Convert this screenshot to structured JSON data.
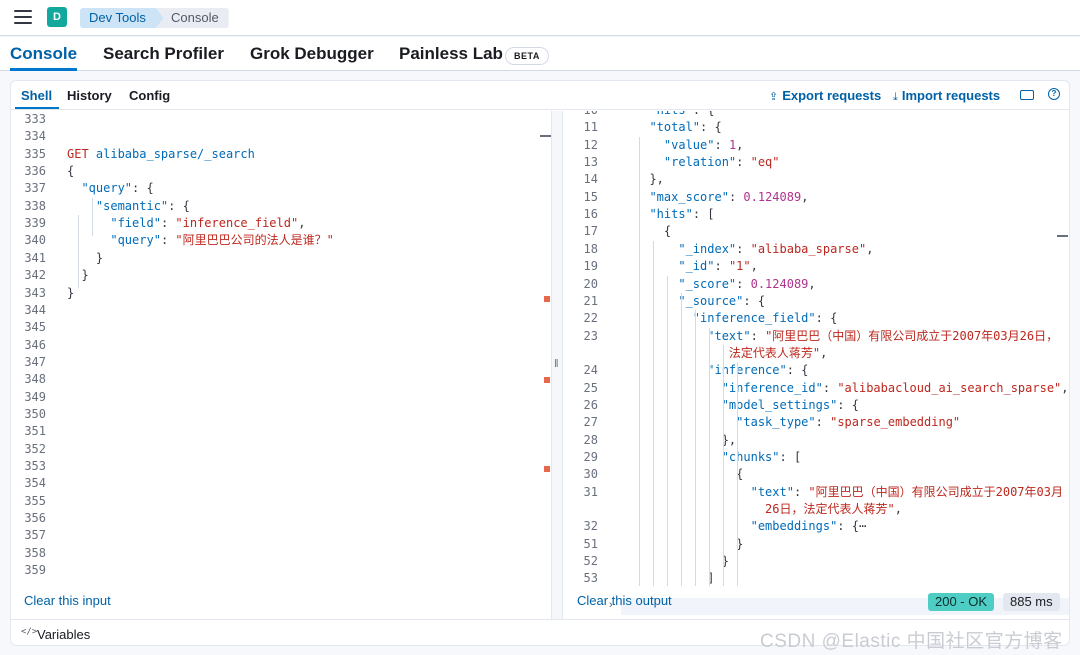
{
  "breadcrumbs": {
    "avatar_letter": "D",
    "root": "Dev Tools",
    "current": "Console"
  },
  "app_tabs": [
    "Console",
    "Search Profiler",
    "Grok Debugger",
    "Painless Lab"
  ],
  "beta_badge": "BETA",
  "sub_tabs": [
    "Shell",
    "History",
    "Config"
  ],
  "actions": {
    "export": "Export requests",
    "import": "Import requests"
  },
  "help_glyph": "?",
  "input_gutter": [
    "333",
    "334",
    "335",
    "336",
    "337",
    "338",
    "339",
    "340",
    "341",
    "342",
    "343",
    "344",
    "345",
    "346",
    "347",
    "348",
    "349",
    "350",
    "351",
    "352",
    "353",
    "354",
    "355",
    "356",
    "357",
    "358",
    "359"
  ],
  "input_code": [
    {
      "n": 2,
      "parts": [
        [
          "kw",
          "GET "
        ],
        [
          "path",
          "alibaba_sparse/_search"
        ]
      ]
    },
    {
      "n": 3,
      "parts": [
        [
          "pun",
          "{"
        ]
      ]
    },
    {
      "n": 4,
      "parts": [
        [
          "pun",
          "  "
        ],
        [
          "key",
          "\"query\""
        ],
        [
          "pun",
          ": {"
        ]
      ]
    },
    {
      "n": 5,
      "parts": [
        [
          "pun",
          "    "
        ],
        [
          "key",
          "\"semantic\""
        ],
        [
          "pun",
          ": {"
        ]
      ]
    },
    {
      "n": 6,
      "parts": [
        [
          "pun",
          "      "
        ],
        [
          "key",
          "\"field\""
        ],
        [
          "pun",
          ": "
        ],
        [
          "str",
          "\"inference_field\""
        ],
        [
          "pun",
          ","
        ]
      ]
    },
    {
      "n": 7,
      "parts": [
        [
          "pun",
          "      "
        ],
        [
          "key",
          "\"query\""
        ],
        [
          "pun",
          ": "
        ],
        [
          "str",
          "\"阿里巴巴公司的法人是谁？\""
        ]
      ]
    },
    {
      "n": 8,
      "parts": [
        [
          "pun",
          "    }"
        ]
      ]
    },
    {
      "n": 9,
      "parts": [
        [
          "pun",
          "  }"
        ]
      ]
    },
    {
      "n": 10,
      "parts": [
        [
          "pun",
          "}"
        ]
      ]
    }
  ],
  "output_lines": [
    {
      "ln": "10",
      "parts": [
        [
          "pun",
          "  "
        ],
        [
          "key",
          "\"hits\""
        ],
        [
          "pun",
          ": {"
        ]
      ]
    },
    {
      "ln": "11",
      "parts": [
        [
          "pun",
          "  "
        ],
        [
          "key",
          "\"total\""
        ],
        [
          "pun",
          ": {"
        ]
      ]
    },
    {
      "ln": "12",
      "parts": [
        [
          "pun",
          "    "
        ],
        [
          "key",
          "\"value\""
        ],
        [
          "pun",
          ": "
        ],
        [
          "num",
          "1"
        ],
        [
          "pun",
          ","
        ]
      ]
    },
    {
      "ln": "13",
      "parts": [
        [
          "pun",
          "    "
        ],
        [
          "key",
          "\"relation\""
        ],
        [
          "pun",
          ": "
        ],
        [
          "str",
          "\"eq\""
        ]
      ]
    },
    {
      "ln": "14",
      "parts": [
        [
          "pun",
          "  },"
        ]
      ]
    },
    {
      "ln": "15",
      "parts": [
        [
          "pun",
          "  "
        ],
        [
          "key",
          "\"max_score\""
        ],
        [
          "pun",
          ": "
        ],
        [
          "num",
          "0.124089"
        ],
        [
          "pun",
          ","
        ]
      ]
    },
    {
      "ln": "16",
      "parts": [
        [
          "pun",
          "  "
        ],
        [
          "key",
          "\"hits\""
        ],
        [
          "pun",
          ": ["
        ]
      ]
    },
    {
      "ln": "17",
      "parts": [
        [
          "pun",
          "    {"
        ]
      ]
    },
    {
      "ln": "18",
      "parts": [
        [
          "pun",
          "      "
        ],
        [
          "key",
          "\"_index\""
        ],
        [
          "pun",
          ": "
        ],
        [
          "str",
          "\"alibaba_sparse\""
        ],
        [
          "pun",
          ","
        ]
      ]
    },
    {
      "ln": "19",
      "parts": [
        [
          "pun",
          "      "
        ],
        [
          "key",
          "\"_id\""
        ],
        [
          "pun",
          ": "
        ],
        [
          "str",
          "\"1\""
        ],
        [
          "pun",
          ","
        ]
      ]
    },
    {
      "ln": "20",
      "parts": [
        [
          "pun",
          "      "
        ],
        [
          "key",
          "\"_score\""
        ],
        [
          "pun",
          ": "
        ],
        [
          "num",
          "0.124089"
        ],
        [
          "pun",
          ","
        ]
      ]
    },
    {
      "ln": "21",
      "parts": [
        [
          "pun",
          "      "
        ],
        [
          "key",
          "\"_source\""
        ],
        [
          "pun",
          ": {"
        ]
      ]
    },
    {
      "ln": "22",
      "parts": [
        [
          "pun",
          "        "
        ],
        [
          "key",
          "\"inference_field\""
        ],
        [
          "pun",
          ": {"
        ]
      ]
    },
    {
      "ln": "23",
      "parts": [
        [
          "pun",
          "          "
        ],
        [
          "key",
          "\"text\""
        ],
        [
          "pun",
          ": "
        ],
        [
          "str",
          "\"阿里巴巴（中国）有限公司成立于2007年03月26日，"
        ]
      ]
    },
    {
      "ln": "",
      "parts": [
        [
          "str",
          "             法定代表人蒋芳\""
        ],
        [
          "pun",
          ","
        ]
      ]
    },
    {
      "ln": "24",
      "parts": [
        [
          "pun",
          "          "
        ],
        [
          "key",
          "\"inference\""
        ],
        [
          "pun",
          ": {"
        ]
      ]
    },
    {
      "ln": "25",
      "parts": [
        [
          "pun",
          "            "
        ],
        [
          "key",
          "\"inference_id\""
        ],
        [
          "pun",
          ": "
        ],
        [
          "str",
          "\"alibabacloud_ai_search_sparse\""
        ],
        [
          "pun",
          ","
        ]
      ]
    },
    {
      "ln": "26",
      "parts": [
        [
          "pun",
          "            "
        ],
        [
          "key",
          "\"model_settings\""
        ],
        [
          "pun",
          ": {"
        ]
      ]
    },
    {
      "ln": "27",
      "parts": [
        [
          "pun",
          "              "
        ],
        [
          "key",
          "\"task_type\""
        ],
        [
          "pun",
          ": "
        ],
        [
          "str",
          "\"sparse_embedding\""
        ]
      ]
    },
    {
      "ln": "28",
      "parts": [
        [
          "pun",
          "            },"
        ]
      ]
    },
    {
      "ln": "29",
      "parts": [
        [
          "pun",
          "            "
        ],
        [
          "key",
          "\"chunks\""
        ],
        [
          "pun",
          ": ["
        ]
      ]
    },
    {
      "ln": "30",
      "parts": [
        [
          "pun",
          "              {"
        ]
      ]
    },
    {
      "ln": "31",
      "parts": [
        [
          "pun",
          "                "
        ],
        [
          "key",
          "\"text\""
        ],
        [
          "pun",
          ": "
        ],
        [
          "str",
          "\"阿里巴巴（中国）有限公司成立于2007年03月"
        ]
      ]
    },
    {
      "ln": "",
      "parts": [
        [
          "str",
          "                  26日，法定代表人蒋芳\""
        ],
        [
          "pun",
          ","
        ]
      ]
    },
    {
      "ln": "32",
      "parts": [
        [
          "pun",
          "                "
        ],
        [
          "key",
          "\"embeddings\""
        ],
        [
          "pun",
          ": {⋯"
        ]
      ]
    },
    {
      "ln": "51",
      "parts": [
        [
          "pun",
          "              }"
        ]
      ]
    },
    {
      "ln": "52",
      "parts": [
        [
          "pun",
          "            }"
        ]
      ]
    },
    {
      "ln": "53",
      "parts": [
        [
          "pun",
          "          ]"
        ]
      ]
    }
  ],
  "clear_input": "Clear this input",
  "clear_output": "Clear this output",
  "status": {
    "code": "200 - OK",
    "time": "885 ms",
    "ok_color": "#4ecdc4"
  },
  "variables_icon": "</>",
  "variables_label": "Variables",
  "watermark": "CSDN @Elastic 中国社区官方博客"
}
